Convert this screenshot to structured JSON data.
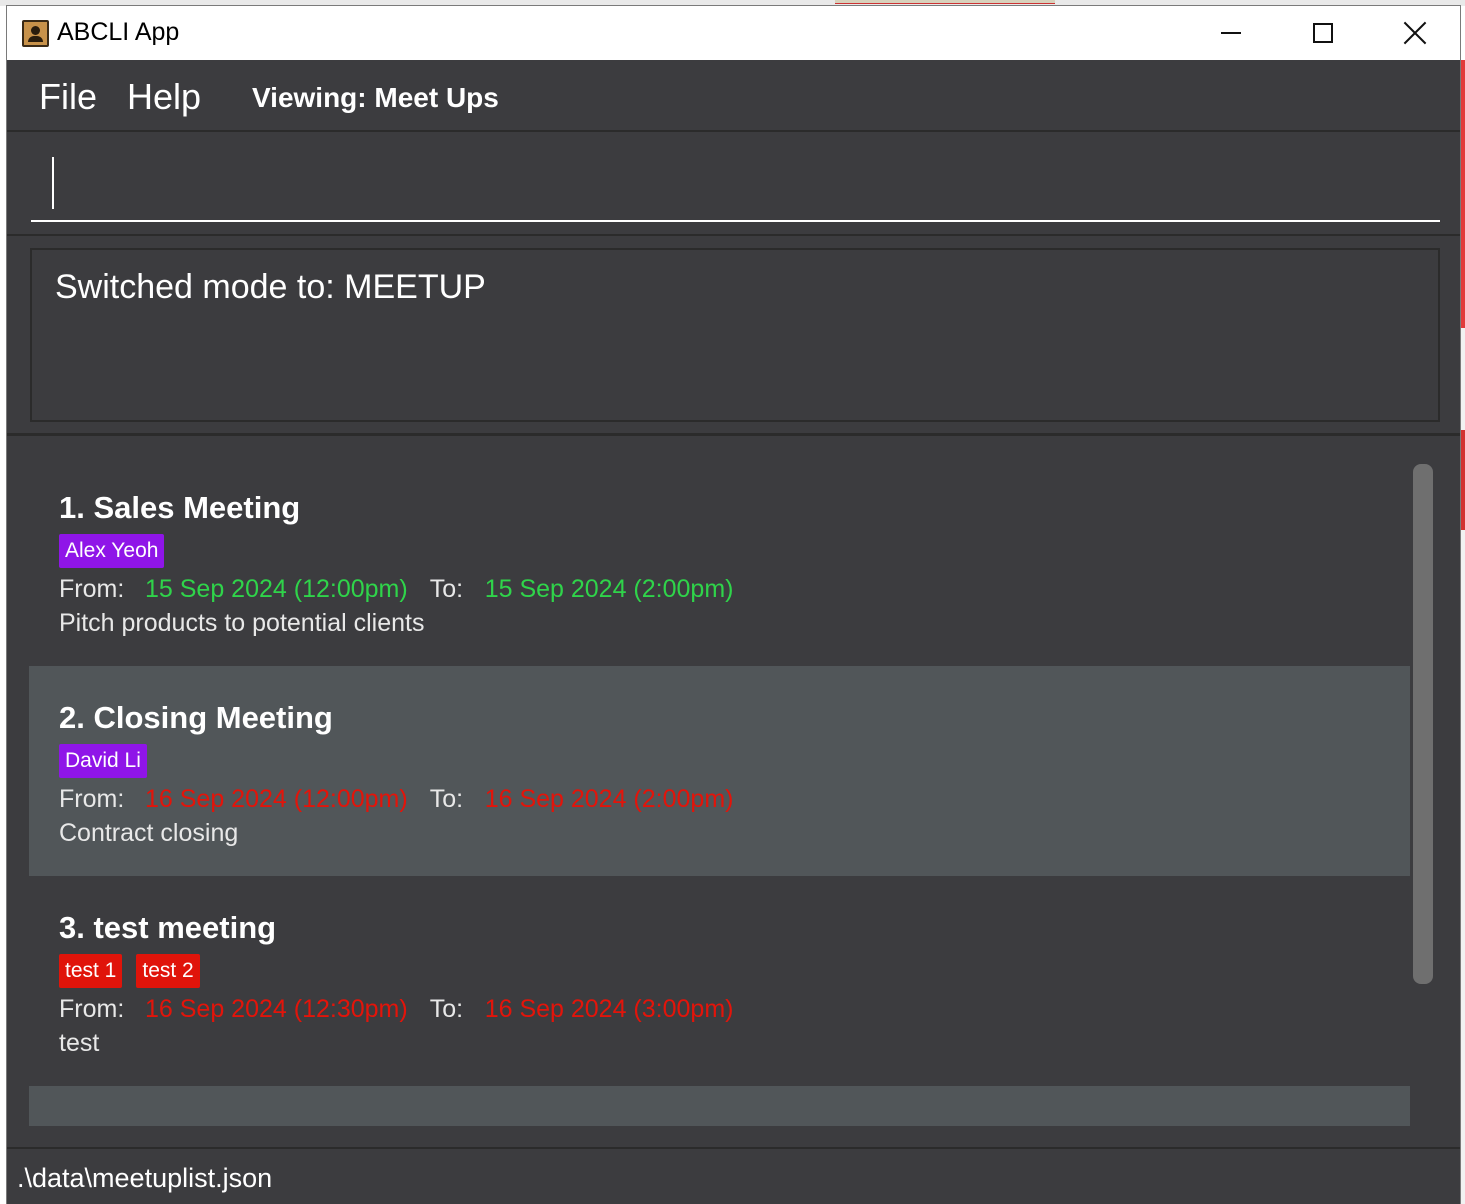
{
  "window": {
    "title": "ABCLI App",
    "icon": "address-book-icon"
  },
  "menu": {
    "file": "File",
    "help": "Help",
    "viewing": "Viewing: Meet Ups"
  },
  "command": {
    "value": "",
    "placeholder": ""
  },
  "result": {
    "message": "Switched mode to: MEETUP"
  },
  "labels": {
    "from": "From:",
    "to": "To:"
  },
  "meetups": [
    {
      "title": "1. Sales Meeting",
      "tags": [
        "Alex Yeoh"
      ],
      "from": "15 Sep 2024 (12:00pm)",
      "to": "15 Sep 2024 (2:00pm)",
      "description": "Pitch products to potential clients"
    },
    {
      "title": "2. Closing Meeting",
      "tags": [
        "David Li"
      ],
      "from": "16 Sep 2024 (12:00pm)",
      "to": "16 Sep 2024 (2:00pm)",
      "description": "Contract closing"
    },
    {
      "title": "3. test meeting",
      "tags": [
        "test 1",
        "test 2"
      ],
      "from": "16 Sep 2024 (12:30pm)",
      "to": "16 Sep 2024 (3:00pm)",
      "description": "test"
    }
  ],
  "status": {
    "file_path": ".\\data\\meetuplist.json"
  },
  "colors": {
    "tag_contact": "#8f15e8",
    "tag_other": "#e0140a",
    "date_ok": "#2fd44a",
    "date_conflict": "#e3140a",
    "background": "#3c3c3f",
    "card_alt": "#515659"
  }
}
